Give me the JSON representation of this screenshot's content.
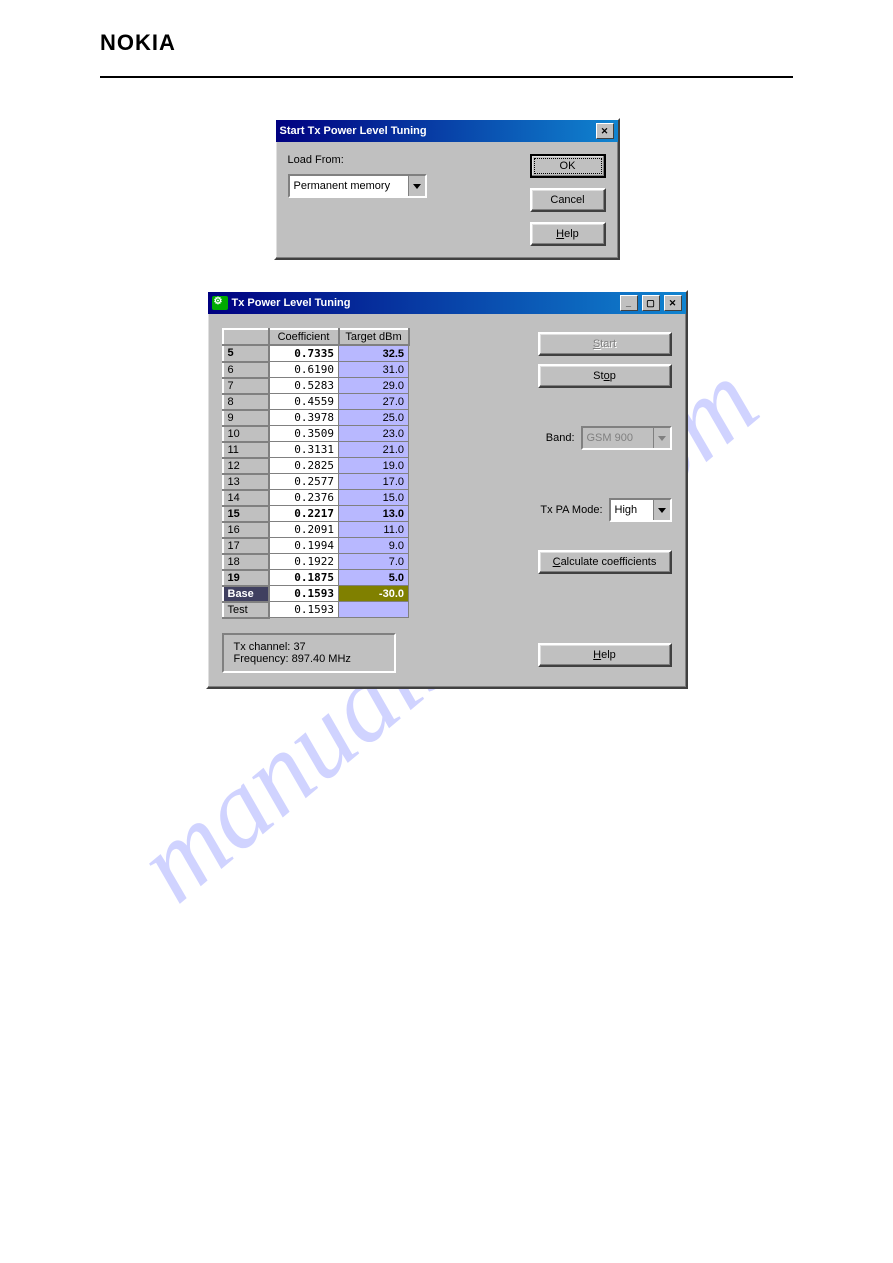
{
  "header": {
    "brand": "NOKIA"
  },
  "watermark": "manualshive.com",
  "dialog1": {
    "title": "Start Tx Power Level Tuning",
    "load_label": "Load From:",
    "load_value": "Permanent memory",
    "ok": "OK",
    "cancel": "Cancel",
    "help_u": "H",
    "help_rest": "elp"
  },
  "dialog2": {
    "title": "Tx Power Level Tuning",
    "table": {
      "headers": [
        "Coefficient",
        "Target dBm"
      ],
      "rows": [
        {
          "level": "5",
          "coef": "0.7335",
          "target": "32.5"
        },
        {
          "level": "6",
          "coef": "0.6190",
          "target": "31.0"
        },
        {
          "level": "7",
          "coef": "0.5283",
          "target": "29.0"
        },
        {
          "level": "8",
          "coef": "0.4559",
          "target": "27.0"
        },
        {
          "level": "9",
          "coef": "0.3978",
          "target": "25.0"
        },
        {
          "level": "10",
          "coef": "0.3509",
          "target": "23.0"
        },
        {
          "level": "11",
          "coef": "0.3131",
          "target": "21.0"
        },
        {
          "level": "12",
          "coef": "0.2825",
          "target": "19.0"
        },
        {
          "level": "13",
          "coef": "0.2577",
          "target": "17.0"
        },
        {
          "level": "14",
          "coef": "0.2376",
          "target": "15.0"
        },
        {
          "level": "15",
          "coef": "0.2217",
          "target": "13.0"
        },
        {
          "level": "16",
          "coef": "0.2091",
          "target": "11.0"
        },
        {
          "level": "17",
          "coef": "0.1994",
          "target": "9.0"
        },
        {
          "level": "18",
          "coef": "0.1922",
          "target": "7.0"
        },
        {
          "level": "19",
          "coef": "0.1875",
          "target": "5.0"
        },
        {
          "level": "Base",
          "coef": "0.1593",
          "target": "-30.0"
        },
        {
          "level": "Test",
          "coef": "0.1593",
          "target": ""
        }
      ]
    },
    "band_label": "Band:",
    "band_value": "GSM 900",
    "pa_label": "Tx PA Mode:",
    "pa_value": "High",
    "buttons": {
      "start_u": "S",
      "start_rest": "tart",
      "stop_pre": "St",
      "stop_u": "o",
      "stop_rest": "p",
      "calc_u": "C",
      "calc_rest": "alculate coefficients",
      "help_u": "H",
      "help_rest": "elp"
    },
    "status": {
      "channel_label": "Tx channel:",
      "channel": "37",
      "freq_label": "Frequency:",
      "freq": "897.40 MHz"
    }
  }
}
